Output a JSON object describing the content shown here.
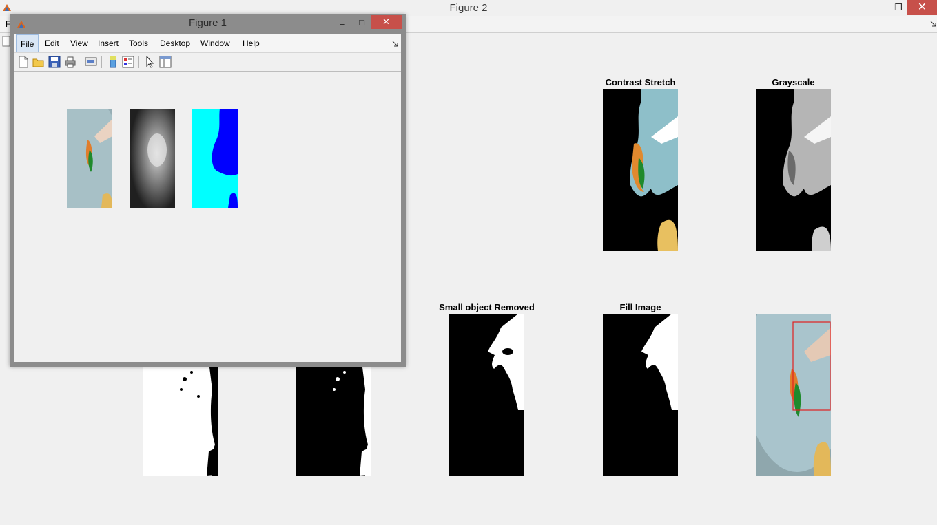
{
  "figure2": {
    "title": "Figure 2",
    "menu_first_letter": "F",
    "axes": [
      {
        "title": "Contrast Stretch"
      },
      {
        "title": "Grayscale"
      },
      {
        "title": "Small object Removed"
      },
      {
        "title": "Fill Image"
      }
    ],
    "window_controls": {
      "minimize": "–",
      "restore": "❐",
      "close": "✕"
    }
  },
  "figure1": {
    "title": "Figure 1",
    "menu": [
      "File",
      "Edit",
      "View",
      "Insert",
      "Tools",
      "Desktop",
      "Window",
      "Help"
    ],
    "window_controls": {
      "minimize": "–",
      "maximize": "□",
      "close": "✕"
    },
    "toolbar_icons": [
      "new-figure-icon",
      "open-file-icon",
      "save-icon",
      "print-icon",
      "print-figure-icon",
      "colorbar-icon",
      "legend-icon",
      "edit-plot-icon",
      "property-editor-icon"
    ]
  },
  "colors": {
    "title_close": "#c7504a",
    "cyan": "#00ffff",
    "blue": "#0000ff",
    "bbox": "#e02020"
  }
}
